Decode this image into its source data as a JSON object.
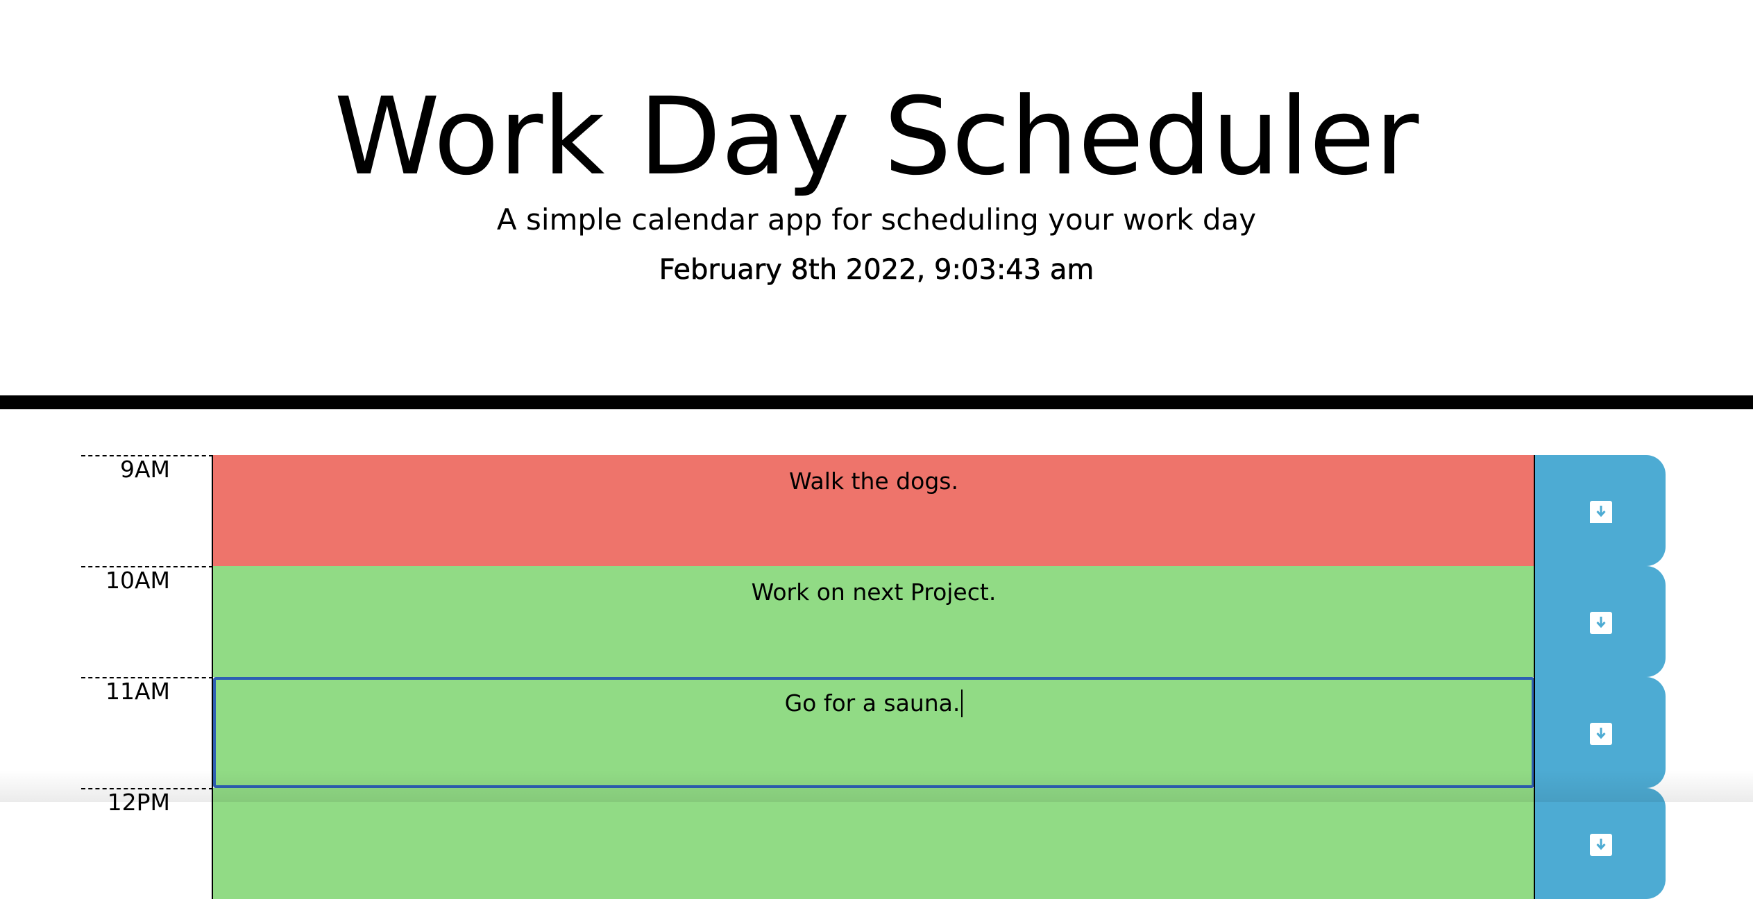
{
  "header": {
    "title": "Work Day Scheduler",
    "subtitle": "A simple calendar app for scheduling your work day",
    "current_day": "February 8th 2022, 9:03:43 am"
  },
  "timeblocks": [
    {
      "hour": "9AM",
      "text": "Walk the dogs.",
      "status": "present"
    },
    {
      "hour": "10AM",
      "text": "Work on next Project.",
      "status": "future"
    },
    {
      "hour": "11AM",
      "text": "Go for a sauna.",
      "status": "future",
      "focused": true
    },
    {
      "hour": "12PM",
      "text": "",
      "status": "future"
    }
  ],
  "save_icon": "save-icon",
  "colors": {
    "past": "#d3d3d3",
    "present": "#ee746b",
    "future": "#91db85",
    "save_button": "#4dabd3",
    "focus_border": "#2d5fb3"
  }
}
